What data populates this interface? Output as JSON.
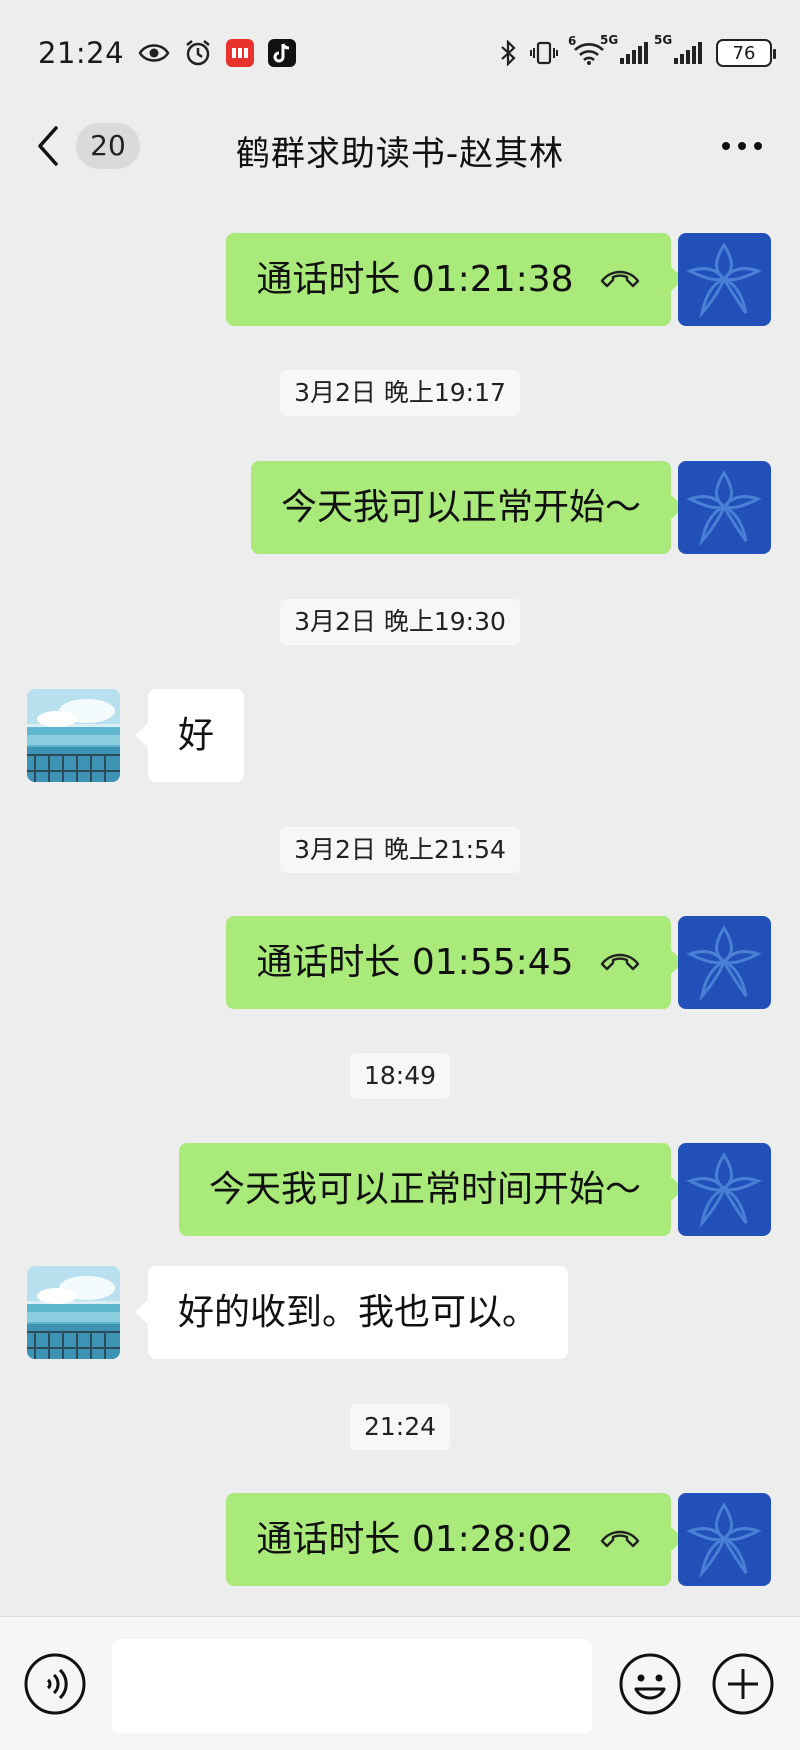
{
  "status_bar": {
    "time": "21:24",
    "battery": "76",
    "network_1": "5G",
    "network_2": "5G",
    "wifi_tag": "6",
    "icons": [
      "eye-icon",
      "alarm-icon",
      "app-icon",
      "tiktok-icon",
      "bluetooth-icon",
      "vibrate-icon",
      "wifi-icon",
      "signal-icon",
      "signal-icon",
      "battery-icon"
    ]
  },
  "header": {
    "unread_count": "20",
    "title": "鹤群求助读书-赵其林",
    "back_icon": "chevron-left-icon",
    "more_icon": "more-dots-icon"
  },
  "messages": [
    {
      "type": "call",
      "sender": "me",
      "text": "通话时长 01:21:38"
    },
    {
      "type": "timestamp",
      "text": "3月2日 晚上19:17"
    },
    {
      "type": "text",
      "sender": "me",
      "text": "今天我可以正常开始～"
    },
    {
      "type": "timestamp",
      "text": "3月2日 晚上19:30"
    },
    {
      "type": "text",
      "sender": "them",
      "text": "好"
    },
    {
      "type": "timestamp",
      "text": "3月2日 晚上21:54"
    },
    {
      "type": "call",
      "sender": "me",
      "text": "通话时长 01:55:45"
    },
    {
      "type": "timestamp",
      "text": "18:49"
    },
    {
      "type": "text",
      "sender": "me",
      "text": "今天我可以正常时间开始～"
    },
    {
      "type": "text",
      "sender": "them",
      "text": "好的收到。我也可以。"
    },
    {
      "type": "timestamp",
      "text": "21:24"
    },
    {
      "type": "call",
      "sender": "me",
      "text": "通话时长 01:28:02"
    }
  ],
  "input_bar": {
    "value": "",
    "voice_icon": "voice-icon",
    "emoji_icon": "emoji-icon",
    "plus_icon": "plus-icon"
  },
  "colors": {
    "background": "#ededed",
    "my_bubble": "#a9ea7a",
    "their_bubble": "#ffffff",
    "my_avatar": "#2150b8"
  }
}
